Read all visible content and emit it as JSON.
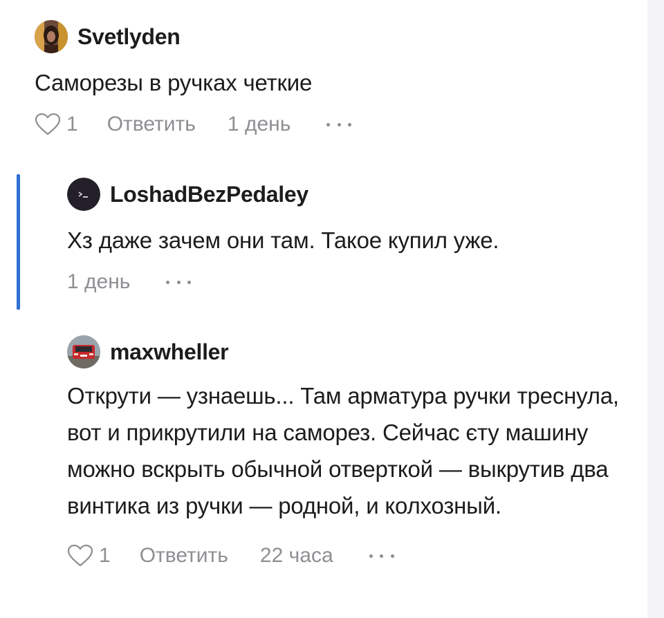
{
  "comments": [
    {
      "author": "Svetlyden",
      "text": "Саморезы в ручках четкие",
      "likes": "1",
      "reply_label": "Ответить",
      "time": "1 день"
    },
    {
      "author": "LoshadBezPedaley",
      "text": "Хз даже зачем они там. Такое купил уже.",
      "time": "1 день"
    },
    {
      "author": "maxwheller",
      "text": "Открути — узнаешь... Там арматура ручки треснула, вот и прикрутили на саморез. Сейчас єту машину можно вскрыть обычной отверткой — выкрутив два винтика из ручки — родной, и колхозный.",
      "likes": "1",
      "reply_label": "Ответить",
      "time": "22 часа"
    }
  ],
  "colors": {
    "accent": "#2f6fd6",
    "muted": "#8e8e93",
    "text": "#1c1c1e"
  },
  "icons": {
    "like": "heart-icon",
    "more": "more-dots-icon"
  }
}
